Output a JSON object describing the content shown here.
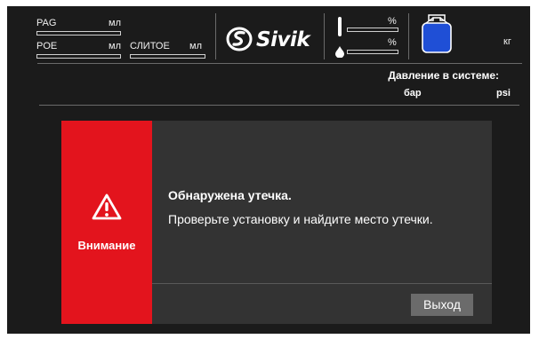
{
  "header": {
    "pag_label": "PAG",
    "pag_unit": "мл",
    "poe_label": "POE",
    "poe_unit": "мл",
    "drain_label": "СЛИТОЕ",
    "drain_unit": "мл",
    "brand": "Sivik",
    "temp_unit": "%",
    "humidity_unit": "%",
    "tank_unit": "кг",
    "pressure_title": "Давление в системе:",
    "pressure_unit_bar": "бар",
    "pressure_unit_psi": "psi"
  },
  "dialog": {
    "side_label": "Внимание",
    "title": "Обнаружена утечка.",
    "message": "Проверьте установку и найдите место утечки.",
    "exit_label": "Выход"
  },
  "colors": {
    "alert_red": "#e3141d",
    "tank_blue": "#1f4fd6",
    "screen_bg": "#1b1b1b",
    "dialog_bg": "#333333"
  },
  "icons": [
    "thermometer-icon",
    "drop-icon",
    "refrigerant-tank-icon",
    "warning-icon",
    "sivik-logo-icon"
  ]
}
